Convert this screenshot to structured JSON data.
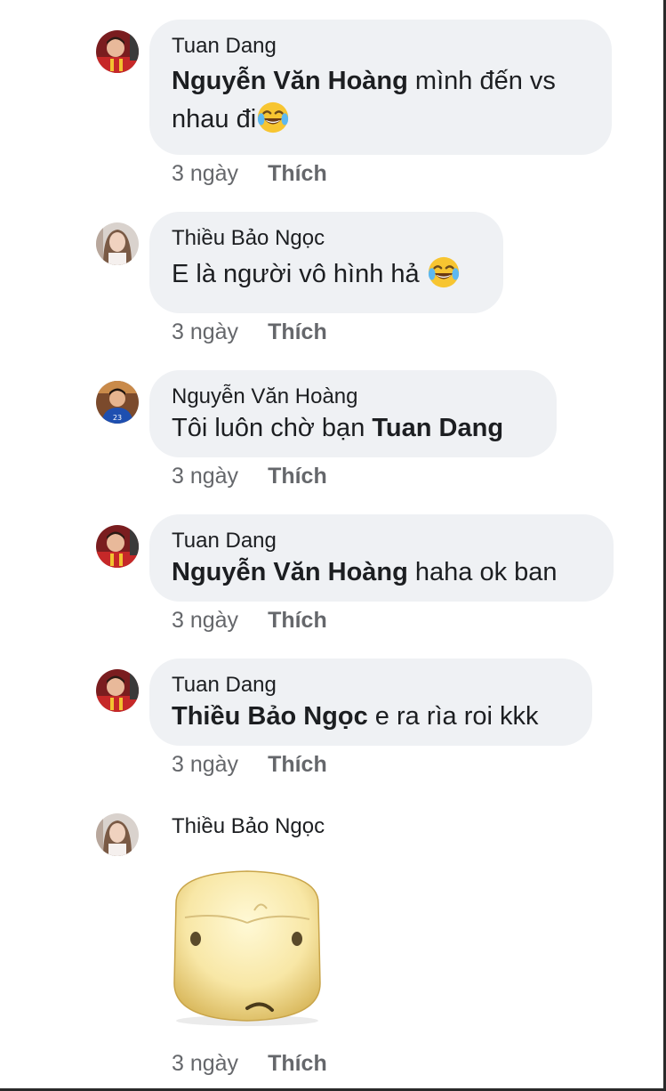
{
  "comments": [
    {
      "author": "Tuan Dang",
      "mention": "Nguyễn Văn Hoàng",
      "text_after_mention": " mình đến vs",
      "line2": "nhau đi",
      "emoji": "face-with-tears-of-joy-icon",
      "time": "3 ngày",
      "like": "Thích"
    },
    {
      "author": "Thiều Bảo Ngọc",
      "text": "E là người vô hình hả ",
      "emoji": "face-with-tears-of-joy-icon",
      "time": "3 ngày",
      "like": "Thích"
    },
    {
      "author": "Nguyễn Văn Hoàng",
      "text_before_mention": "Tôi luôn chờ bạn ",
      "mention": "Tuan Dang",
      "time": "3 ngày",
      "like": "Thích"
    },
    {
      "author": "Tuan Dang",
      "mention": "Nguyễn Văn Hoàng",
      "text_after_mention": " haha ok ban",
      "time": "3 ngày",
      "like": "Thích"
    },
    {
      "author": "Tuan Dang",
      "mention": "Thiều Bảo Ngọc",
      "text_after_mention": " e ra rìa roi kkk",
      "time": "3 ngày",
      "like": "Thích"
    },
    {
      "author": "Thiều Bảo Ngọc",
      "sticker": "worried-face-sticker",
      "time": "3 ngày",
      "like": "Thích"
    }
  ],
  "colors": {
    "bubble": "#eff1f4",
    "meta_text": "#65676b",
    "primary_text": "#1c1e21"
  }
}
